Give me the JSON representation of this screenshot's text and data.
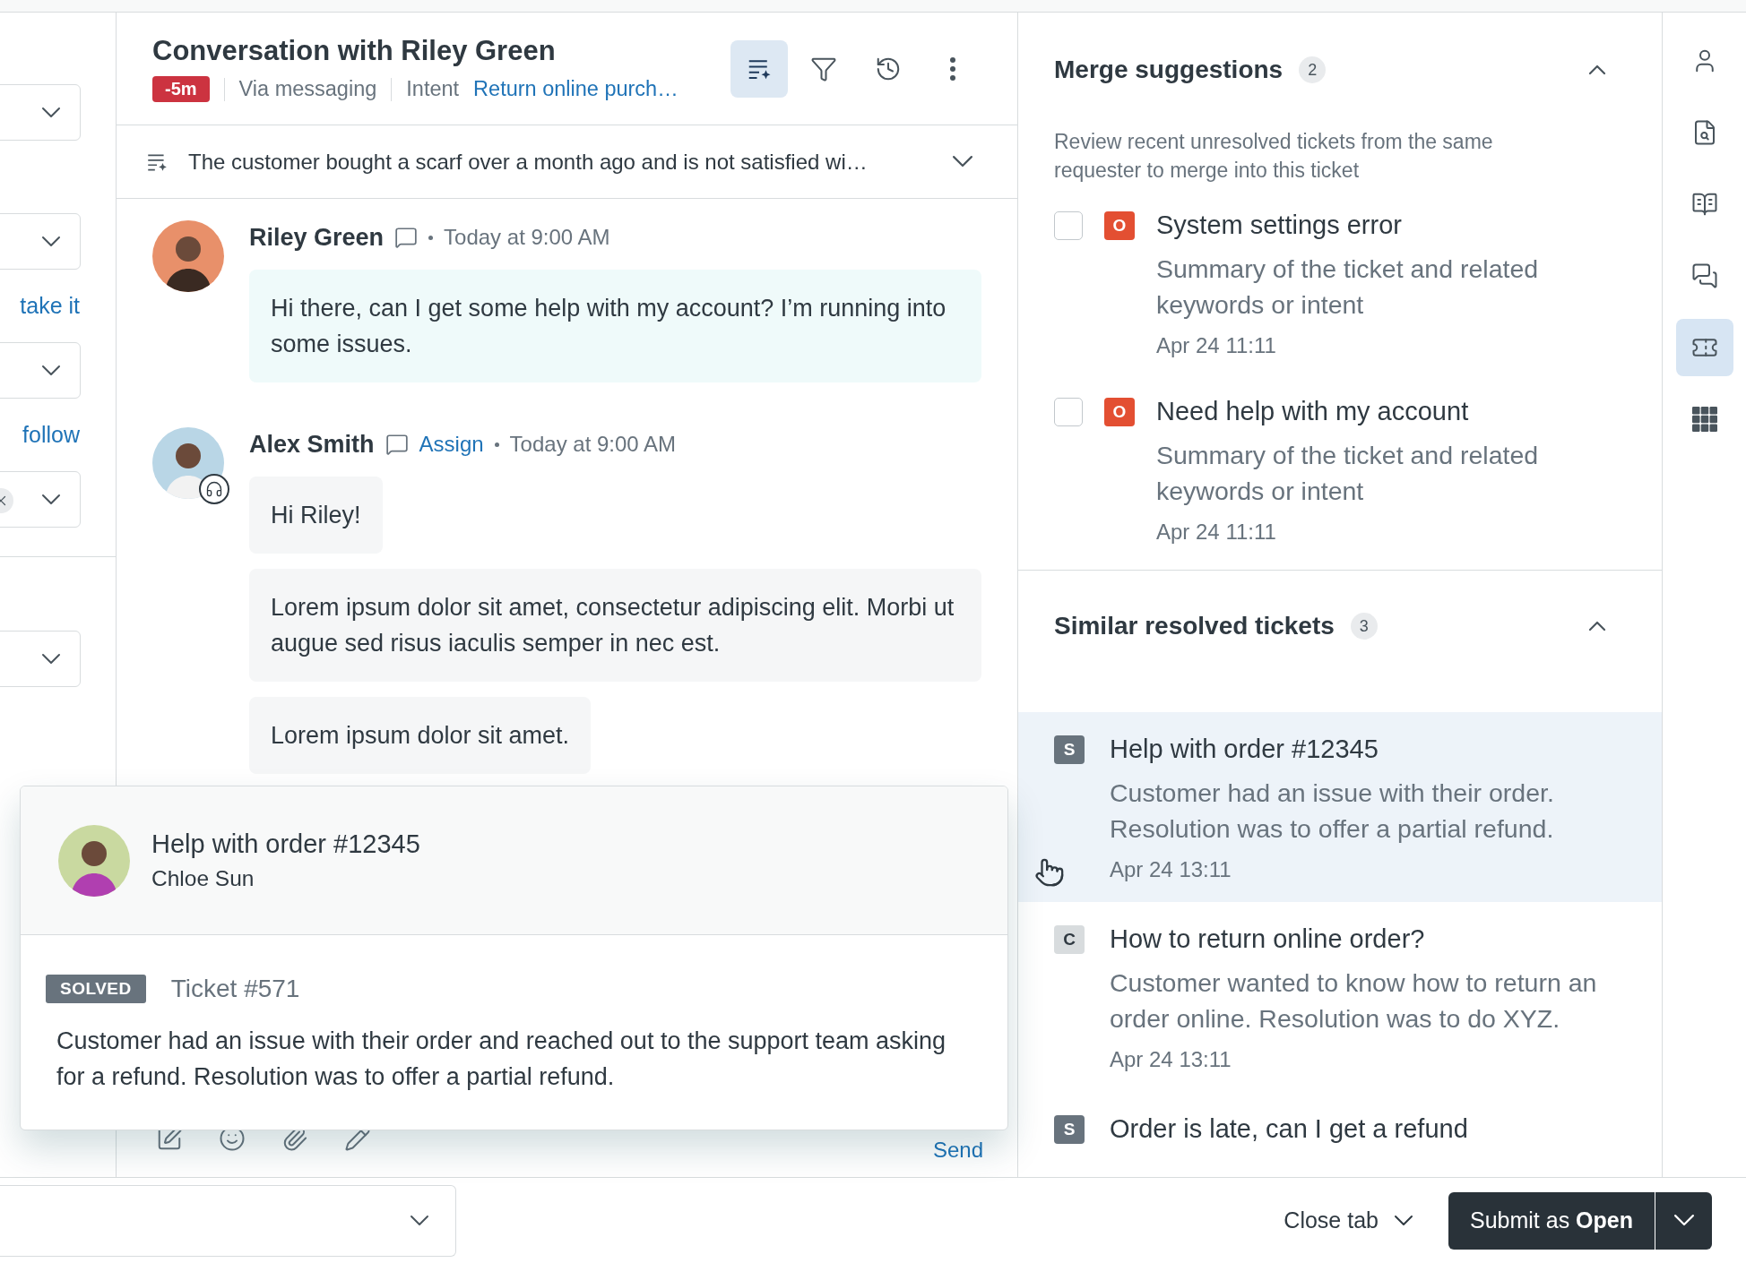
{
  "left_column": {
    "sections": [
      {
        "items": [
          {
            "kind": "dropdown"
          },
          {
            "kind": "dropdown"
          },
          {
            "kind": "link",
            "label": "take it"
          },
          {
            "kind": "dropdown"
          },
          {
            "kind": "link",
            "label": "follow"
          },
          {
            "kind": "clearable_dropdown"
          }
        ]
      },
      {
        "items": [
          {
            "kind": "dropdown"
          }
        ]
      }
    ]
  },
  "conversation": {
    "title": "Conversation with Riley Green",
    "sla_badge": "-5m",
    "channel": "Via messaging",
    "intent_label": "Intent",
    "intent_value": "Return online purch…",
    "toolbar": [
      {
        "kind": "summary",
        "selected": true
      },
      {
        "kind": "filter",
        "selected": false
      },
      {
        "kind": "history",
        "selected": false
      },
      {
        "kind": "more",
        "selected": false
      }
    ],
    "summary": "The customer bought a scarf over a month ago and is not satisfied wi…",
    "messages": [
      {
        "author": "Riley Green",
        "kind": "customer",
        "time": "Today at 9:00 AM",
        "bubbles": [
          "Hi there, can I get some help with my account? I’m running into some issues."
        ]
      },
      {
        "author": "Alex Smith",
        "kind": "agent",
        "assign": "Assign",
        "time": "Today at 9:00 AM",
        "bubbles": [
          "Hi Riley!",
          "Lorem ipsum dolor sit amet, consectetur adipiscing elit. Morbi ut augue sed risus iaculis semper in nec est.",
          "Lorem ipsum dolor sit amet."
        ]
      }
    ],
    "composer": {
      "tools": [
        {
          "kind": "note"
        },
        {
          "kind": "emoji"
        },
        {
          "kind": "attach"
        },
        {
          "kind": "draw"
        }
      ],
      "send": "Send"
    }
  },
  "merge_suggestions": {
    "title": "Merge suggestions",
    "count": "2",
    "expanded": true,
    "description": "Review recent unresolved tickets from the same requester to merge into this ticket",
    "tickets": [
      {
        "status": "O",
        "color": "#e34f32",
        "title": "System settings error",
        "summary": "Summary of the ticket and related keywords or intent",
        "date": "Apr 24 11:11",
        "checked": false
      },
      {
        "status": "O",
        "color": "#e34f32",
        "title": "Need help with my account",
        "summary": "Summary of the ticket and related keywords or intent",
        "date": "Apr 24 11:11",
        "checked": false
      }
    ]
  },
  "similar_tickets": {
    "title": "Similar resolved tickets",
    "count": "3",
    "expanded": true,
    "tickets": [
      {
        "status": "S",
        "color": "#68737d",
        "title": "Help with order #12345",
        "summary": "Customer had an issue with their order. Resolution was to offer a partial refund.",
        "date": "Apr 24 13:11",
        "selected": true
      },
      {
        "status": "C",
        "color": "#d8dcde",
        "title": "How to return online order?",
        "summary": "Customer wanted to know how to return an order online. Resolution was to do XYZ.",
        "date": "Apr 24 13:11",
        "selected": false
      },
      {
        "status": "S",
        "color": "#68737d",
        "title": "Order is late, can I get a refund",
        "selected": false
      }
    ]
  },
  "rail": [
    {
      "kind": "user",
      "selected": false
    },
    {
      "kind": "knowledge",
      "selected": false
    },
    {
      "kind": "book",
      "selected": false
    },
    {
      "kind": "conversations",
      "selected": false
    },
    {
      "kind": "tickets",
      "selected": true
    },
    {
      "kind": "apps",
      "selected": false
    }
  ],
  "popover": {
    "title": "Help with order #12345",
    "requester": "Chloe Sun",
    "status": "SOLVED",
    "ticket": "Ticket #571",
    "description": "Customer had an issue with their order and reached out to the support team asking for a refund. Resolution was to offer a partial refund."
  },
  "footer": {
    "close_tab": "Close tab",
    "submit": "Submit as **Open**"
  }
}
